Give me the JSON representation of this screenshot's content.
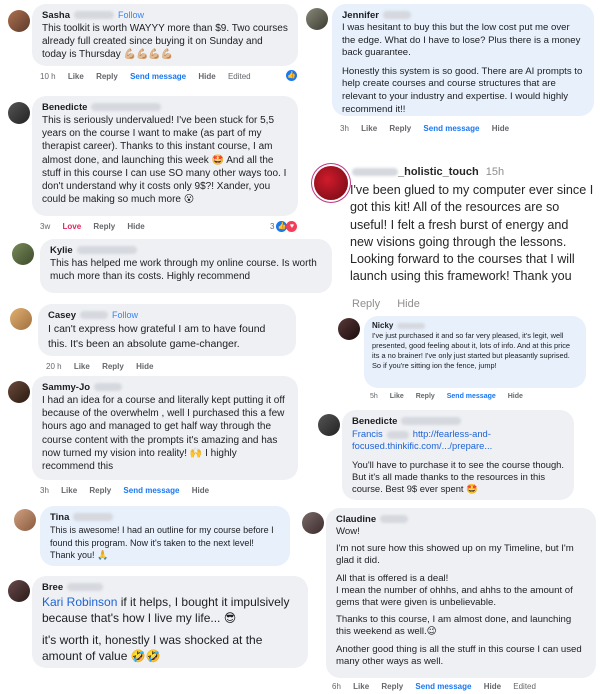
{
  "comments": {
    "sasha": {
      "name": "Sasha",
      "follow": "Follow",
      "text": "This toolkit is worth WAYYY more than $9. Two courses already full created since buying it on Sunday and today is Thursday 💪🏼💪🏼💪🏼💪🏼",
      "time": "10 h",
      "like": "Like",
      "reply": "Reply",
      "send": "Send message",
      "hide": "Hide",
      "edited": "Edited"
    },
    "benedicte1": {
      "name": "Benedicte",
      "text": "This is seriously undervalued! I've been stuck for 5,5 years on the course I want to make (as part of my therapist career). Thanks to this instant course, I am almost done, and launching this week 🤩 And all the stuff in this course I can use SO many other ways too. I don't understand why it costs only 9$?! Xander, you could be making so much more 😮",
      "time": "3w",
      "love": "Love",
      "reply": "Reply",
      "hide": "Hide",
      "reactions": "3"
    },
    "kylie": {
      "name": "Kylie",
      "text": "This has helped me work through my online course. Is worth much more than its costs. Highly recommend"
    },
    "casey": {
      "name": "Casey",
      "follow": "Follow",
      "text": "I can't express how grateful I am to have found this. It's been an absolute game-changer.",
      "time": "20 h",
      "like": "Like",
      "reply": "Reply",
      "hide": "Hide"
    },
    "sammy": {
      "name": "Sammy-Jo",
      "text": "I had an idea for a course and literally kept putting it off because of the overwhelm , well I purchased this a few hours ago and managed to get half way through the course content with the prompts it's amazing and has now turned my vision into reality! 🙌 I highly recommend this",
      "time": "3h",
      "like": "Like",
      "reply": "Reply",
      "send": "Send message",
      "hide": "Hide"
    },
    "tina": {
      "name": "Tina",
      "text": "This is awesome! I had an outline for my course before I found this program. Now it's taken to the next level! Thank you! 🙏"
    },
    "bree": {
      "name": "Bree",
      "mention": "Kari Robinson",
      "text1": " if it helps, I bought it impulsively because that's how I live my life... 😎",
      "text2": "it's worth it, honestly I was shocked at the amount of value 🤣🤣"
    },
    "jennifer": {
      "name": "Jennifer",
      "text1": "I was hesitant to buy this but the low cost put me over the edge. What do I have to lose? Plus there is a money back guarantee.",
      "text2": "Honestly this system is so good. There are AI prompts to help create courses and course structures that are relevant to your industry and expertise. I would highly recommend it!!",
      "time": "3h",
      "like": "Like",
      "reply": "Reply",
      "send": "Send message",
      "hide": "Hide"
    },
    "precious": {
      "name": "_holistic_touch",
      "time": "15h",
      "text": "I've been glued to my computer ever since I got this kit! All of the resources are so useful! I felt a fresh burst of energy and new visions going through the lessons. Looking forward to the courses that I will launch using this framework! Thank you",
      "reply": "Reply",
      "hide": "Hide"
    },
    "nicky": {
      "name": "Nicky",
      "text": "I've just purchased it and so far very pleased, it's legit, well presented, good feeling about it, lots of info. And at this price its a no brainer! I've only just started but pleasantly suprised. So if you're sitting ion the fence, jump!",
      "time": "5h",
      "like": "Like",
      "reply": "Reply",
      "send": "Send message",
      "hide": "Hide"
    },
    "benedicte2": {
      "name": "Benedicte",
      "mention": "Francis",
      "link": "http://fearless-and-focused.thinkific.com/.../prepare...",
      "text": "You'll have to purchase it to see the course though. But it's all made thanks to the resources in this course. Best 9$ ever spent 🤩"
    },
    "claudine": {
      "name": "Claudine",
      "p1": "Wow!",
      "p2": "I'm not sure how this showed up on my Timeline, but I'm glad it did.",
      "p3": "All that is offered is a deal!\nI mean the number of ohhhs, and ahhs to the amount of gems that were given is unbelievable.",
      "p4": "Thanks to this course, I am almost done, and launching this weekend as well.😉",
      "p5": "Another good thing is all the stuff in this course I can used many other ways as well.",
      "time": "6h",
      "like": "Like",
      "reply": "Reply",
      "send": "Send message",
      "hide": "Hide",
      "edited": "Edited"
    }
  },
  "colors": {
    "bubble": "#eef0f3",
    "bubble_blue": "#e7f0fb",
    "link": "#1d63d8",
    "action": "#65676b"
  }
}
